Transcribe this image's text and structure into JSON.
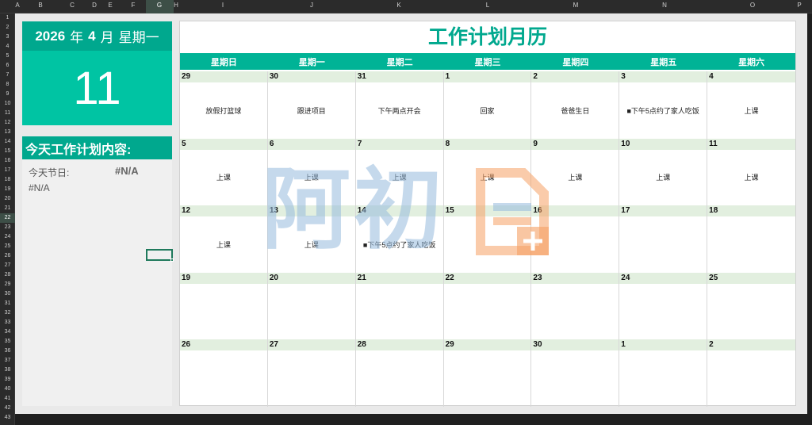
{
  "spreadsheet": {
    "columns": [
      "A",
      "B",
      "C",
      "D",
      "E",
      "F",
      "G",
      "H",
      "I",
      "J",
      "K",
      "L",
      "M",
      "N",
      "O",
      "P"
    ],
    "selected_column": "G",
    "rows": [
      "1",
      "2",
      "3",
      "4",
      "5",
      "6",
      "7",
      "8",
      "9",
      "10",
      "11",
      "12",
      "13",
      "14",
      "15",
      "16",
      "17",
      "18",
      "19",
      "20",
      "21",
      "22",
      "23",
      "24",
      "25",
      "26",
      "27",
      "28",
      "29",
      "30",
      "31",
      "32",
      "33",
      "34",
      "35",
      "36",
      "37",
      "38",
      "39",
      "40",
      "41",
      "42",
      "43"
    ],
    "selected_row": "22"
  },
  "header": {
    "year": "2026",
    "year_suffix": "年",
    "month": "4",
    "month_suffix": "月",
    "weekday": "星期一",
    "day": "11"
  },
  "plan": {
    "title": "今天工作计划内容:",
    "holiday_label": "今天节日:",
    "holiday_value": "#N/A",
    "content": "#N/A"
  },
  "calendar": {
    "title": "工作计划月历",
    "weekdays": [
      "星期日",
      "星期一",
      "星期二",
      "星期三",
      "星期四",
      "星期五",
      "星期六"
    ],
    "weeks": [
      [
        {
          "day": "29",
          "event": "放假打篮球"
        },
        {
          "day": "30",
          "event": "跟进项目"
        },
        {
          "day": "31",
          "event": "下午两点开会"
        },
        {
          "day": "1",
          "event": "回家"
        },
        {
          "day": "2",
          "event": "爸爸生日"
        },
        {
          "day": "3",
          "event": "■下午5点约了家人吃饭"
        },
        {
          "day": "4",
          "event": "上课"
        }
      ],
      [
        {
          "day": "5",
          "event": "上课"
        },
        {
          "day": "6",
          "event": "上课"
        },
        {
          "day": "7",
          "event": "上课"
        },
        {
          "day": "8",
          "event": "上课"
        },
        {
          "day": "9",
          "event": "上课"
        },
        {
          "day": "10",
          "event": "上课"
        },
        {
          "day": "11",
          "event": "上课"
        }
      ],
      [
        {
          "day": "12",
          "event": "上课"
        },
        {
          "day": "13",
          "event": "上课"
        },
        {
          "day": "14",
          "event": "■下午5点约了家人吃饭"
        },
        {
          "day": "15",
          "event": ""
        },
        {
          "day": "16",
          "event": ""
        },
        {
          "day": "17",
          "event": ""
        },
        {
          "day": "18",
          "event": ""
        }
      ],
      [
        {
          "day": "19",
          "event": ""
        },
        {
          "day": "20",
          "event": ""
        },
        {
          "day": "21",
          "event": ""
        },
        {
          "day": "22",
          "event": ""
        },
        {
          "day": "23",
          "event": ""
        },
        {
          "day": "24",
          "event": ""
        },
        {
          "day": "25",
          "event": ""
        }
      ],
      [
        {
          "day": "26",
          "event": ""
        },
        {
          "day": "27",
          "event": ""
        },
        {
          "day": "28",
          "event": ""
        },
        {
          "day": "29",
          "event": ""
        },
        {
          "day": "30",
          "event": ""
        },
        {
          "day": "1",
          "event": ""
        },
        {
          "day": "2",
          "event": ""
        }
      ]
    ]
  },
  "watermark": {
    "text": "阿初",
    "logo_icon": "document-plus-icon"
  },
  "colors": {
    "accent": "#00a88e",
    "accent_light": "#00c4a3",
    "day_row": "#e2efdf"
  }
}
